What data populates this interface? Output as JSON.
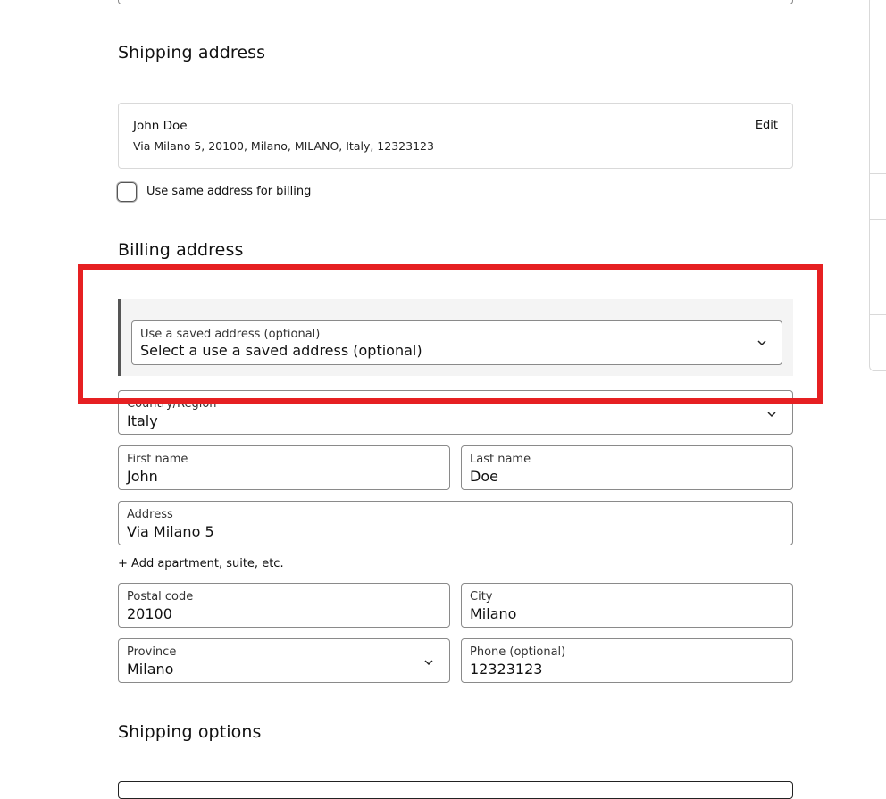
{
  "shipping": {
    "title": "Shipping address",
    "card": {
      "name": "John Doe",
      "address_line": "Via Milano 5, 20100, Milano, MILANO, Italy, 12323123",
      "edit_label": "Edit"
    },
    "same_billing_label": "Use same address for billing",
    "same_billing_checked": false
  },
  "billing": {
    "title": "Billing address",
    "saved_address": {
      "label": "Use a saved address (optional)",
      "value": "Select a use a saved address (optional)"
    },
    "country": {
      "label": "Country/Region",
      "value": "Italy"
    },
    "first_name": {
      "label": "First name",
      "value": "John"
    },
    "last_name": {
      "label": "Last name",
      "value": "Doe"
    },
    "address": {
      "label": "Address",
      "value": "Via Milano 5"
    },
    "add_apartment_label": "+ Add apartment, suite, etc.",
    "postal_code": {
      "label": "Postal code",
      "value": "20100"
    },
    "city": {
      "label": "City",
      "value": "Milano"
    },
    "province": {
      "label": "Province",
      "value": "Milano"
    },
    "phone": {
      "label": "Phone (optional)",
      "value": "12323123"
    }
  },
  "shipping_options": {
    "title": "Shipping options"
  },
  "highlight": {
    "color": "#e62022"
  },
  "icons": {
    "select_chevron": "chevron-down-icon"
  }
}
